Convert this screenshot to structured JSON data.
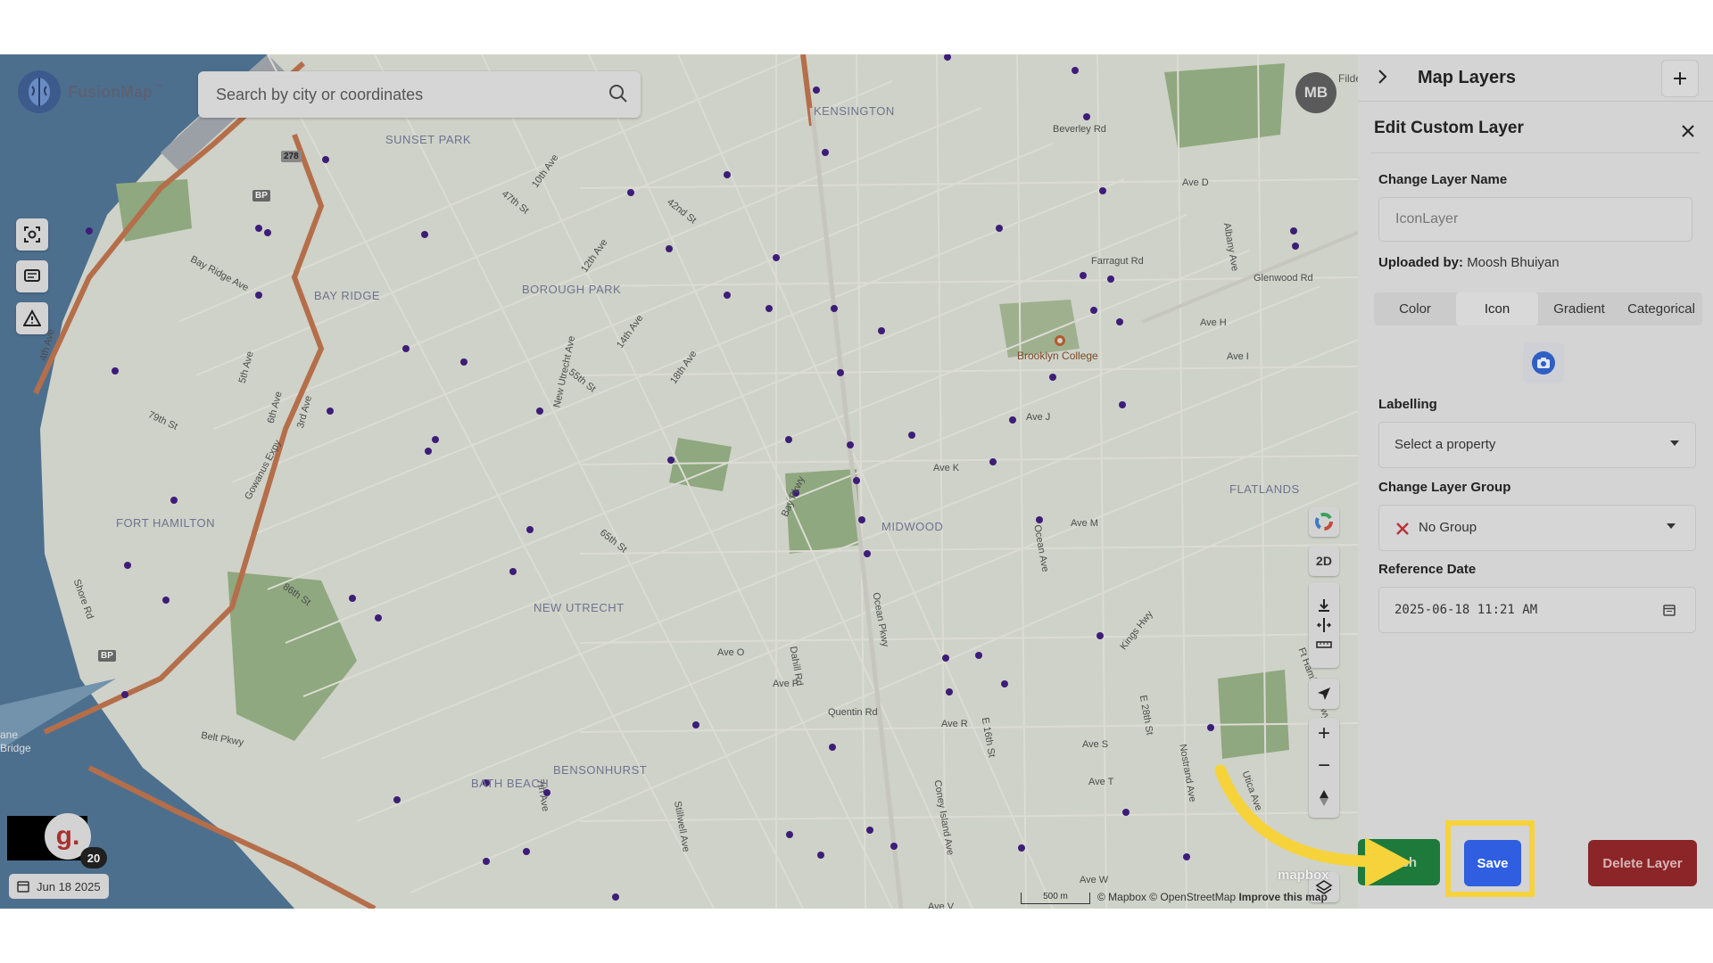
{
  "brand": {
    "name": "FusionMap",
    "tm": "™"
  },
  "search": {
    "placeholder": "Search by city or coordinates"
  },
  "user": {
    "initials": "MB",
    "tail": "Filder"
  },
  "badge": {
    "letter": "g.",
    "count": "20"
  },
  "date_chip": {
    "label": "Jun 18 2025"
  },
  "map_controls": {
    "mode_2d": "2D"
  },
  "attribution": {
    "scale": "500 m",
    "text": "© Mapbox © OpenStreetMap",
    "improve": "Improve this map",
    "logo": "mapbox"
  },
  "map_labels": {
    "areas": [
      "KENSINGTON",
      "SUNSET PARK",
      "BOROUGH PARK",
      "BAY RIDGE",
      "MIDWOOD",
      "NEW UTRECHT",
      "FORT HAMILTON",
      "BENSONHURST",
      "BATH BEACH",
      "FLATLANDS"
    ],
    "poi": "Brooklyn College",
    "streets": [
      "Beverley Rd",
      "Ave D",
      "Farragut Rd",
      "Glenwood Rd",
      "Ave H",
      "Ave I",
      "Ave J",
      "Ave K",
      "Ave M",
      "Ave O",
      "Ave P",
      "Ave R",
      "Ave S",
      "Ave T",
      "Ave W",
      "Quentin Rd",
      "Kings Hwy",
      "Ocean Pkwy",
      "Bay Pkwy",
      "Belt Pkwy",
      "Gowanus Expy",
      "Shore Rd",
      "New Utrecht Ave",
      "Ocean Ave",
      "Nostrand Ave",
      "Bay Ridge Ave",
      "Stillwell Ave",
      "Dahill Rd",
      "Ave V",
      "Albany Ave",
      "Coney Island Ave",
      "E 28th St",
      "E 16th St",
      "86th St",
      "79th St",
      "65th St",
      "55th St",
      "47th St",
      "42nd St",
      "18th Ave",
      "14th Ave",
      "12th Ave",
      "10th Ave",
      "6th Ave",
      "5th Ave",
      "4th Ave",
      "3rd Ave",
      "7th Ave",
      "Ft Hamilton Pkwy",
      "Utica Ave"
    ],
    "shields": [
      "278",
      "BP",
      "BP"
    ],
    "edge": [
      "ane",
      "Bridge"
    ]
  },
  "panel": {
    "header_title": "Map Layers",
    "edit_title": "Edit Custom Layer",
    "layer_name_label": "Change Layer Name",
    "layer_name_value": "IconLayer",
    "uploaded_by_label": "Uploaded by:",
    "uploaded_by_value": "Moosh Bhuiyan",
    "tabs": [
      "Color",
      "Icon",
      "Gradient",
      "Categorical"
    ],
    "active_tab": "Icon",
    "labelling_label": "Labelling",
    "labelling_value": "Select a property",
    "group_label": "Change Layer Group",
    "group_value": "No Group",
    "date_label": "Reference Date",
    "date_value": "2025-06-18 11:21 AM",
    "publish_label": "ublish",
    "save_label": "Save",
    "delete_label": "Delete Layer"
  },
  "colors": {
    "save_button": "#2f5fe0",
    "publish_button": "#1d7a3a",
    "delete_button": "#8c2528",
    "highlight": "#f6d33b",
    "map_point": "#3d1d78"
  }
}
